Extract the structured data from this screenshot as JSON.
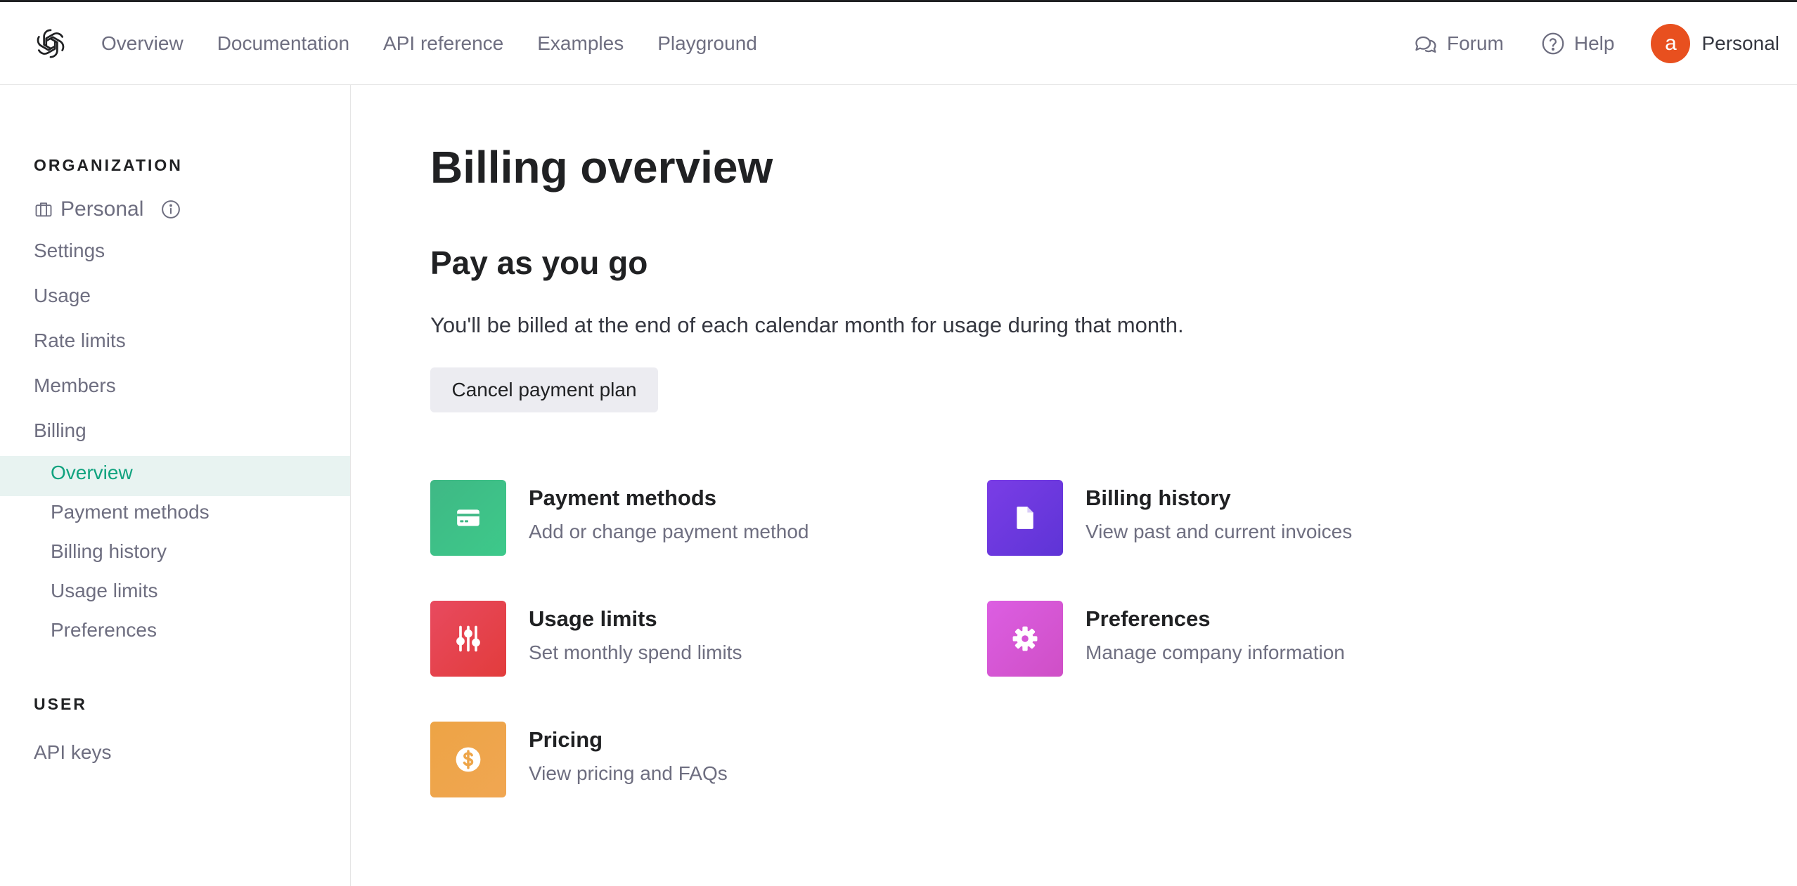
{
  "header": {
    "nav": [
      "Overview",
      "Documentation",
      "API reference",
      "Examples",
      "Playground"
    ],
    "forum": "Forum",
    "help": "Help",
    "avatar_letter": "a",
    "account": "Personal"
  },
  "sidebar": {
    "org_label": "ORGANIZATION",
    "org_name": "Personal",
    "links": [
      "Settings",
      "Usage",
      "Rate limits",
      "Members",
      "Billing"
    ],
    "billing_sub": [
      "Overview",
      "Payment methods",
      "Billing history",
      "Usage limits",
      "Preferences"
    ],
    "user_label": "USER",
    "user_links": [
      "API keys"
    ]
  },
  "main": {
    "title": "Billing overview",
    "plan_title": "Pay as you go",
    "plan_desc": "You'll be billed at the end of each calendar month for usage during that month.",
    "cancel_button": "Cancel payment plan",
    "cards": [
      {
        "title": "Payment methods",
        "sub": "Add or change payment method",
        "icon": "credit-card-icon",
        "color": "#3ebd85"
      },
      {
        "title": "Billing history",
        "sub": "View past and current invoices",
        "icon": "document-icon",
        "color": "#6b3ae0"
      },
      {
        "title": "Usage limits",
        "sub": "Set monthly spend limits",
        "icon": "sliders-icon",
        "color": "#e4444f"
      },
      {
        "title": "Preferences",
        "sub": "Manage company information",
        "icon": "gear-icon",
        "color": "#d556d5"
      },
      {
        "title": "Pricing",
        "sub": "View pricing and FAQs",
        "icon": "dollar-icon",
        "color": "#eea548"
      }
    ]
  },
  "colors": {
    "accent": "#10a37f",
    "active_bg": "#e8f3f1",
    "avatar": "#e8501f"
  }
}
